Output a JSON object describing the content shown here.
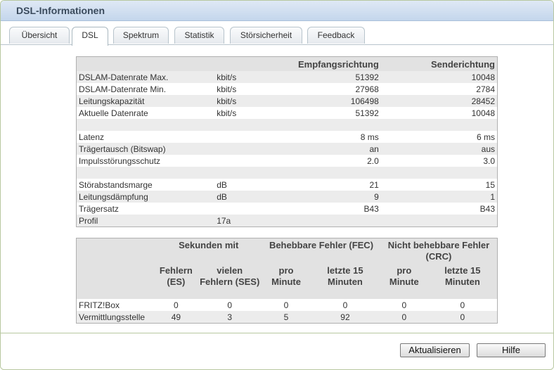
{
  "window": {
    "title": "DSL-Informationen"
  },
  "tabs": [
    {
      "label": "Übersicht"
    },
    {
      "label": "DSL"
    },
    {
      "label": "Spektrum"
    },
    {
      "label": "Statistik"
    },
    {
      "label": "Störsicherheit"
    },
    {
      "label": "Feedback"
    }
  ],
  "active_tab": "DSL",
  "line_table": {
    "headers": {
      "downstream": "Empfangsrichtung",
      "upstream": "Senderichtung"
    },
    "rows": [
      {
        "label": "DSLAM-Datenrate Max.",
        "unit": "kbit/s",
        "down": "51392",
        "up": "10048"
      },
      {
        "label": "DSLAM-Datenrate Min.",
        "unit": "kbit/s",
        "down": "27968",
        "up": "2784"
      },
      {
        "label": "Leitungskapazität",
        "unit": "kbit/s",
        "down": "106498",
        "up": "28452"
      },
      {
        "label": "Aktuelle Datenrate",
        "unit": "kbit/s",
        "down": "51392",
        "up": "10048"
      },
      {
        "label": "Latenz",
        "unit": "",
        "down": "8 ms",
        "up": "6 ms"
      },
      {
        "label": "Trägertausch (Bitswap)",
        "unit": "",
        "down": "an",
        "up": "aus"
      },
      {
        "label": "Impulsstörungsschutz",
        "unit": "",
        "down": "2.0",
        "up": "3.0"
      },
      {
        "label": "Störabstandsmarge",
        "unit": "dB",
        "down": "21",
        "up": "15"
      },
      {
        "label": "Leitungsdämpfung",
        "unit": "dB",
        "down": "9",
        "up": "1"
      },
      {
        "label": "Trägersatz",
        "unit": "",
        "down": "B43",
        "up": "B43"
      },
      {
        "label": "Profil",
        "unit": "17a",
        "down": "",
        "up": ""
      }
    ]
  },
  "error_table": {
    "groups": {
      "seconds": "Sekunden mit",
      "fec": "Behebbare Fehler (FEC)",
      "crc": "Nicht behebbare Fehler (CRC)"
    },
    "subheaders": {
      "es": "Fehlern (ES)",
      "ses": "vielen Fehlern (SES)",
      "fec_min": "pro Minute",
      "fec_15": "letzte 15 Minuten",
      "crc_min": "pro Minute",
      "crc_15": "letzte 15 Minuten"
    },
    "rows": [
      {
        "label": "FRITZ!Box",
        "es": "0",
        "ses": "0",
        "fec_min": "0",
        "fec_15": "0",
        "crc_min": "0",
        "crc_15": "0"
      },
      {
        "label": "Vermittlungsstelle",
        "es": "49",
        "ses": "3",
        "fec_min": "5",
        "fec_15": "92",
        "crc_min": "0",
        "crc_15": "0"
      }
    ]
  },
  "buttons": {
    "refresh": "Aktualisieren",
    "help": "Hilfe"
  },
  "colors": {
    "title_bar": "#c4d6ec",
    "row_shade": "#ececec",
    "header_bg": "#e2e2e2"
  }
}
